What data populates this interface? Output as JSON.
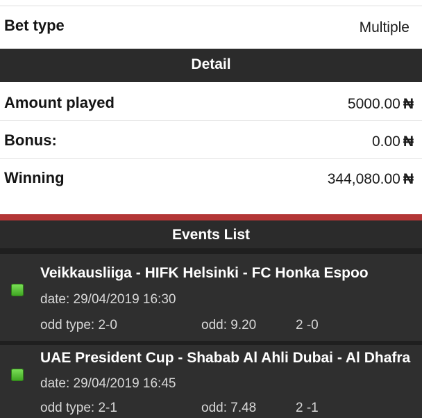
{
  "bet": {
    "label": "Bet type",
    "value": "Multiple"
  },
  "detail": {
    "title": "Detail",
    "rows": [
      {
        "label": "Amount played",
        "value": "5000.00",
        "currency": "₦"
      },
      {
        "label": "Bonus:",
        "value": "0.00",
        "currency": "₦"
      },
      {
        "label": "Winning",
        "value": "344,080.00",
        "currency": "₦"
      }
    ]
  },
  "events": {
    "title": "Events List",
    "items": [
      {
        "name": "Veikkausliiga - HIFK Helsinki - FC Honka Espoo",
        "date": "date: 29/04/2019 16:30",
        "odd_type": "odd type: 2-0",
        "odd": "odd: 9.20",
        "score": "2 -0",
        "status_color": "#4caf2a"
      },
      {
        "name": "UAE President Cup -  Shabab Al Ahli Dubai - Al Dhafra",
        "date": "date: 29/04/2019 16:45",
        "odd_type": "odd type: 2-1",
        "odd": "odd: 7.48",
        "score": "2 -1",
        "status_color": "#4caf2a"
      }
    ]
  },
  "colors": {
    "header_bg": "#2b2b2b",
    "accent_red": "#b33636",
    "event_bg": "#2f2f2f",
    "status_green": "#4caf2a"
  }
}
